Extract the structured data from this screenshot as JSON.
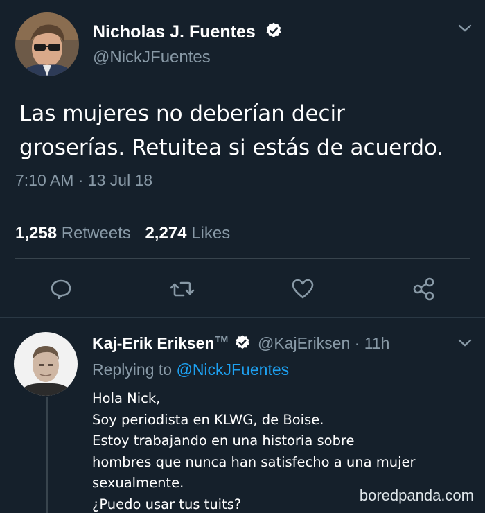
{
  "tweet": {
    "author_name": "Nicholas J. Fuentes",
    "author_handle": "@NickJFuentes",
    "text_lines": [
      "Las mujeres no deberían decir",
      "groserías. Retuitea si estás de acuerdo."
    ],
    "timestamp": "7:10 AM · 13 Jul 18",
    "retweets_count": "1,258",
    "retweets_label": "Retweets",
    "likes_count": "2,274",
    "likes_label": "Likes"
  },
  "reply": {
    "author_name": "Kaj-Erik Eriksen",
    "trademark": "TM",
    "author_handle": "@KajEriksen",
    "time_ago": "· 11h",
    "replying_label": "Replying to",
    "replying_handle": "@NickJFuentes",
    "text_lines": [
      "Hola Nick,",
      "Soy periodista en KLWG, de Boise.",
      "Estoy trabajando en una historia sobre",
      "hombres que nunca han satisfecho a una mujer",
      "sexualmente.",
      "¿Puedo usar tus tuits?"
    ]
  },
  "actions": [
    "reply-icon",
    "retweet-icon",
    "like-icon",
    "share-icon"
  ],
  "watermark": "boredpanda.com",
  "colors": {
    "background": "#15202b",
    "text": "#ffffff",
    "muted": "#8899a6",
    "accent": "#1da1f2",
    "divider": "#38444d"
  }
}
